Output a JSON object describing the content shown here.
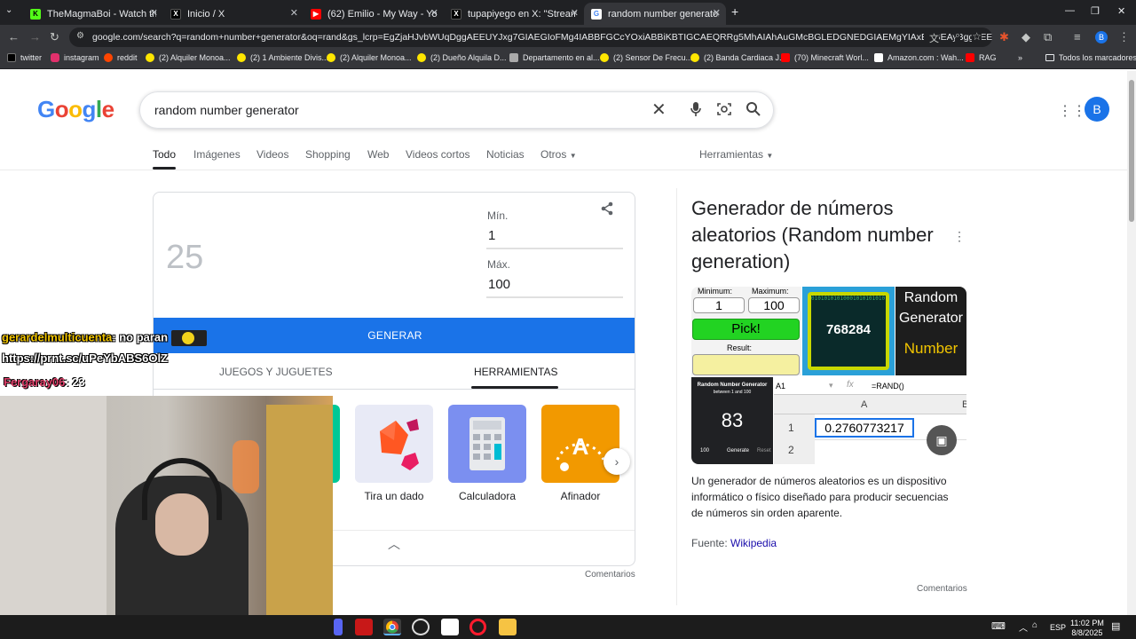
{
  "browser": {
    "tabs": [
      {
        "title": "TheMagmaBoi - Watch the VOD",
        "favicon": "kick-icon",
        "color": "#53fc18"
      },
      {
        "title": "Inicio / X",
        "favicon": "x-icon",
        "color": "#000000"
      },
      {
        "title": "(62) Emilio - My Way - YouTube",
        "favicon": "youtube-icon",
        "color": "#ff0000"
      },
      {
        "title": "tupapiyego en X: \"Streamer sen",
        "favicon": "x-icon",
        "color": "#000000"
      },
      {
        "title": "random number generator - Bu",
        "favicon": "google-icon",
        "color": "#4285f4"
      }
    ],
    "url": "google.com/search?q=random+number+generator&oq=rand&gs_lcrp=EgZjaHJvbWUqDggAEEUYJxg7GIAEGIoFMg4IABBFGCcYOxiABBiKBTIGCAEQRRg5MhAIAhAuGMcBGLEDGNEDGIAEMgYIAxBFGEAyBggEEEUYOzIMCAUQAB",
    "bookmarks": [
      "twitter",
      "instagram",
      "reddit",
      "(2) Alquiler Monoa...",
      "(2) 1 Ambiente Divis...",
      "(2) Alquiler Monoa...",
      "(2) Dueño Alquila D...",
      "Departamento en al...",
      "(2) Sensor De Frecu...",
      "(2) Banda Cardiaca J...",
      "(70) Minecraft Worl...",
      "Amazon.com : Wah...",
      "RAG"
    ],
    "bookmarks_all": "Todos los marcadores"
  },
  "google": {
    "logo": [
      "G",
      "o",
      "o",
      "g",
      "l",
      "e"
    ],
    "logo_colors": [
      "#4285f4",
      "#ea4335",
      "#fbbc05",
      "#4285f4",
      "#34a853",
      "#ea4335"
    ],
    "query": "random number generator",
    "account_initial": "B",
    "nav": [
      "Todo",
      "Imágenes",
      "Videos",
      "Shopping",
      "Web",
      "Videos cortos",
      "Noticias",
      "Otros"
    ],
    "tools": "Herramientas"
  },
  "rng": {
    "result": "25",
    "min_label": "Mín.",
    "min_value": "1",
    "max_label": "Máx.",
    "max_value": "100",
    "generate": "GENERAR",
    "tabs": [
      "JUEGOS Y JUGUETES",
      "HERRAMIENTAS"
    ],
    "tools": [
      {
        "label": "Tira un dado",
        "icon": "dice-icon",
        "bg": "#e8eaf6"
      },
      {
        "label": "Calculadora",
        "icon": "calculator-icon",
        "bg": "#7b8ff0"
      },
      {
        "label": "Afinador",
        "icon": "tuner-icon",
        "bg": "#f29900"
      }
    ],
    "feedback": "Comentarios"
  },
  "knowledge": {
    "title": "Generador de números aleatorios (Random number generation)",
    "img": {
      "min_label": "Minimum:",
      "max_label": "Maximum:",
      "min_val": "1",
      "max_val": "100",
      "pick": "Pick!",
      "result_label": "Result:",
      "big_number": "768284",
      "side_title_1": "Random",
      "side_title_2": "Generator",
      "side_title_3": "Number",
      "rng_header": "Random Number Generator",
      "rng_sub": "between 1 and 100",
      "rng_value": "83",
      "rng_field": "100",
      "rng_btn": "Generate",
      "rng_reset": "Reset",
      "cell_ref": "A1",
      "formula": "=RAND()",
      "col_a": "A",
      "col_b": "B",
      "row1": "1",
      "row2": "2",
      "cell_value": "0.2760773217"
    },
    "description": "Un generador de números aleatorios es un dispositivo informático o físico diseñado para producir secuencias de números sin orden aparente.",
    "source_label": "Fuente:",
    "source_link": "Wikipedia",
    "feedback": "Comentarios"
  },
  "stream_overlay": {
    "chat": [
      {
        "user": "gerardelmulticuenta",
        "message": ": no paran"
      },
      {
        "user": "",
        "message": "https://prnt.sc/uPeYbABS6OlZ"
      },
      {
        "user": "Fergaray06",
        "message": ": 23"
      }
    ]
  },
  "taskbar": {
    "lang": "ESP",
    "time": "11:02 PM",
    "date": "8/8/2025"
  }
}
